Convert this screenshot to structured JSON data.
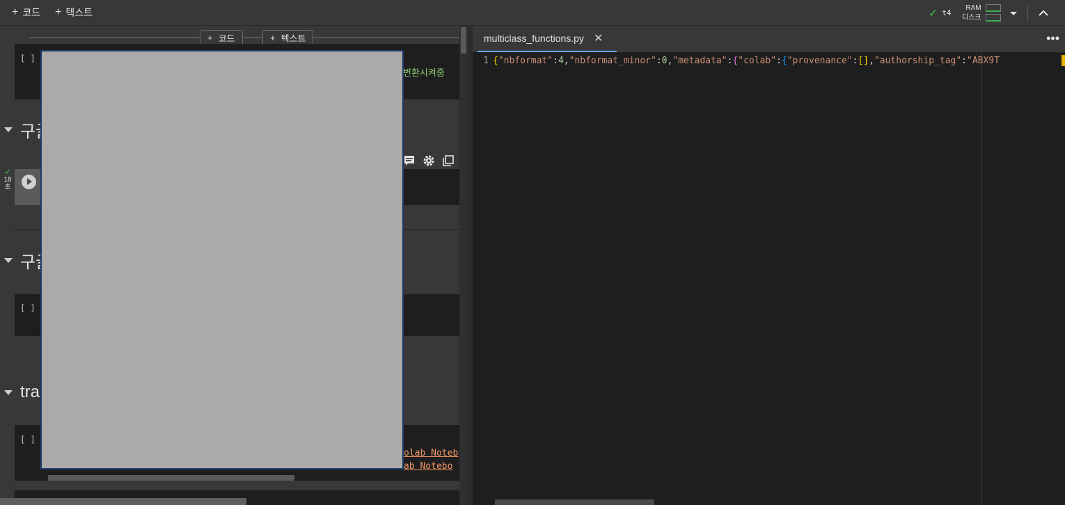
{
  "toolbar": {
    "add_code_label": "코드",
    "add_text_label": "텍스트",
    "runtime_name": "t4",
    "ram_label": "RAM",
    "disk_label": "디스크",
    "accent_green": "#3fbf4f"
  },
  "notebook": {
    "insert_code_label": "코드",
    "insert_text_label": "텍스트",
    "cell1_bracket": "[ ]",
    "cell1_comment_fragment": "변환시켜줌",
    "heading1_prefix": "구글",
    "heading1_suffix": ")",
    "exec_time_value": "18",
    "exec_time_unit": "초",
    "heading2_prefix": "구글",
    "cell3_bracket": "[ ]",
    "heading3_prefix": "tra",
    "cell4_bracket": "[ ]",
    "code_line1_fragment": "olab Noteb",
    "code_line2_fragment": "ab Notebo"
  },
  "editor": {
    "tab_title": "multiclass_functions.py",
    "line_number": "1",
    "tokens": {
      "t1": "{",
      "t2": "\"nbformat\"",
      "t3": ":",
      "t4": "4",
      "t5": ",",
      "t6": "\"nbformat_minor\"",
      "t7": ":",
      "t8": "0",
      "t9": ",",
      "t10": "\"metadata\"",
      "t11": ":",
      "t12": "{",
      "t13": "\"colab\"",
      "t14": ":",
      "t15": "{",
      "t16": "\"provenance\"",
      "t17": ":",
      "t18": "[]",
      "t19": ",",
      "t20": "\"authorship_tag\"",
      "t21": ":",
      "t22": "\"ABX9T"
    }
  },
  "colors": {
    "tab_underline": "#6fa3ff",
    "overlay_gray": "#aaaaaa",
    "string_orange": "#ce9178"
  }
}
